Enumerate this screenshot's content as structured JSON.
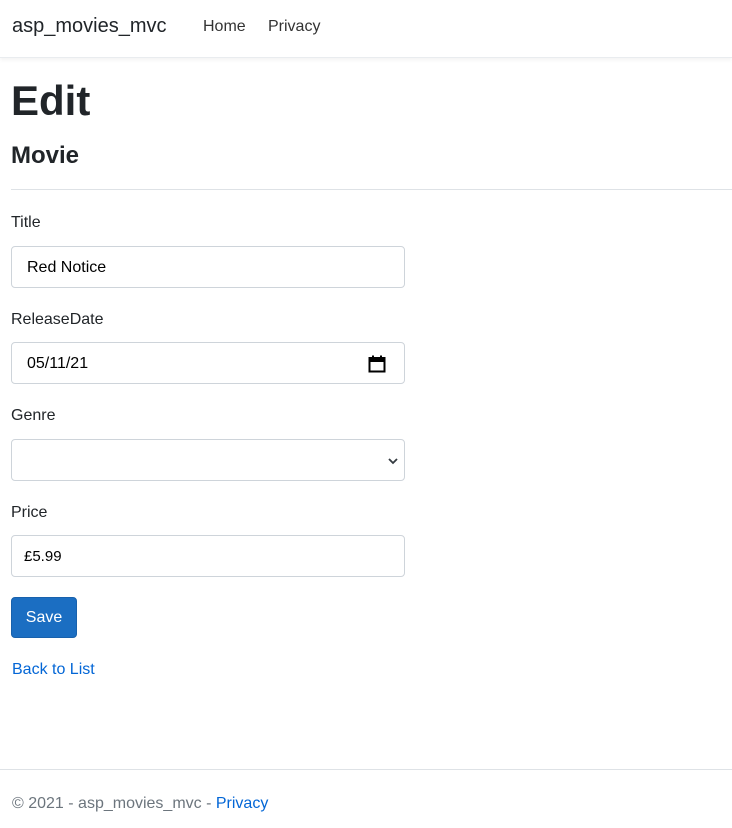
{
  "navbar": {
    "brand": "asp_movies_mvc",
    "links": [
      {
        "label": "Home"
      },
      {
        "label": "Privacy"
      }
    ]
  },
  "page": {
    "title": "Edit",
    "subtitle": "Movie"
  },
  "form": {
    "title": {
      "label": "Title",
      "value": "Red Notice"
    },
    "release_date": {
      "label": "ReleaseDate",
      "value": "05/11/21",
      "icon": "calendar-icon"
    },
    "genre": {
      "label": "Genre",
      "value": "",
      "icon": "chevron-down-icon"
    },
    "price": {
      "label": "Price",
      "value": "£5.99"
    },
    "save_label": "Save"
  },
  "back_link": "Back to List",
  "footer": {
    "copyright": "© 2021 - asp_movies_mvc - ",
    "privacy_label": "Privacy"
  },
  "colors": {
    "primary_button": "#1b6ec2",
    "link": "#0366d6"
  }
}
